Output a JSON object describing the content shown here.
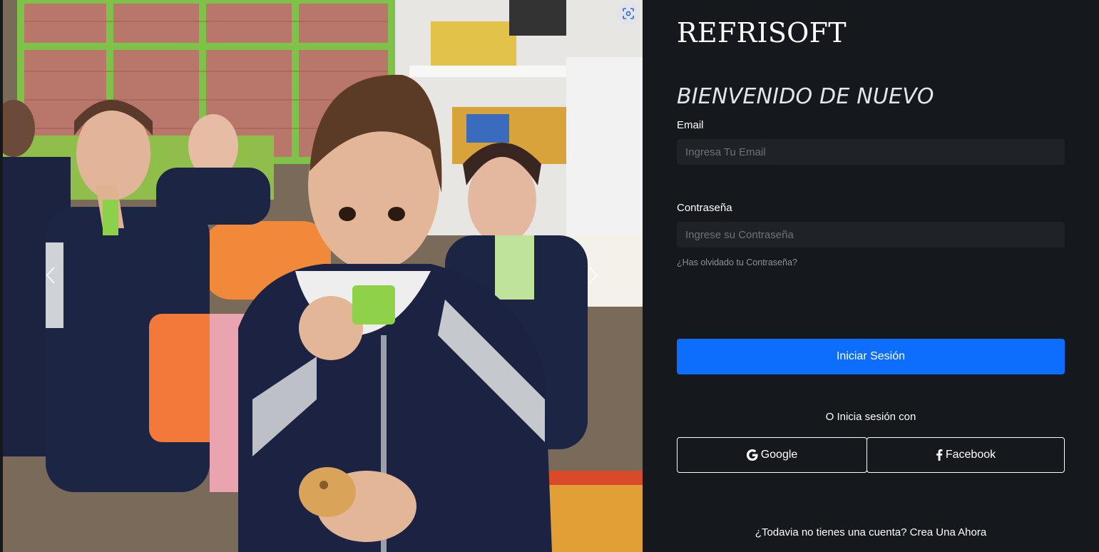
{
  "brand": {
    "name": "REFRISOFT"
  },
  "carousel": {
    "image_icon": "photo-of-children-eating-in-classroom",
    "prev_icon": "chevron-left-icon",
    "next_icon": "chevron-right-icon",
    "visual_search_icon": "visual-search-icon"
  },
  "login": {
    "heading": "BIENVENIDO DE NUEVO",
    "email_label": "Email",
    "email_placeholder": "Ingresa Tu Email",
    "email_value": "",
    "password_label": "Contraseña",
    "password_placeholder": "Ingrese su Contraseña",
    "password_value": "",
    "forgot_password": "¿Has olvidado tu Contraseña?",
    "submit_label": "Iniciar Sesión",
    "or_text": "O Inicia sesión con",
    "google_label": "Google",
    "facebook_label": "Facebook",
    "signup_text": "¿Todavia no tienes una cuenta?",
    "signup_link": "Crea Una Ahora"
  },
  "colors": {
    "panel_background": "#15181c",
    "input_background": "#1f2328",
    "primary_button": "#0d6efd",
    "text": "#ffffff"
  }
}
